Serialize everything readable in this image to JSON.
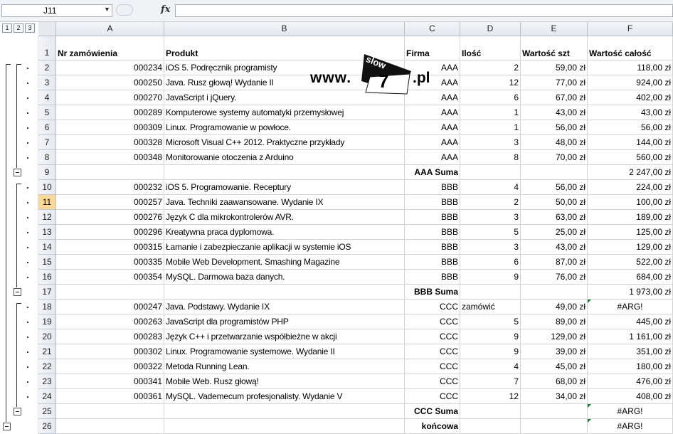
{
  "formula_bar": {
    "name_box": "J11",
    "fx_label": "fx",
    "formula": ""
  },
  "outline_levels": [
    "1",
    "2",
    "3"
  ],
  "columns": [
    "A",
    "B",
    "C",
    "D",
    "E",
    "F"
  ],
  "logo": {
    "www": "www.",
    "slow": "slow",
    "seven": "7",
    "pl": ".pl"
  },
  "active_row": "11",
  "rows": [
    {
      "n": "1",
      "a": "Nr zamówienia",
      "b": "Produkt",
      "c": "Firma",
      "d": "Ilość",
      "e": "Wartość szt",
      "f": "Wartość całość",
      "type": "header"
    },
    {
      "n": "2",
      "a": "000234",
      "b": "iOS 5. Podręcznik programisty",
      "c": "AAA",
      "d": "2",
      "e": "59,00 zł",
      "f": "118,00 zł",
      "type": "data"
    },
    {
      "n": "3",
      "a": "000250",
      "b": "Java. Rusz głową! Wydanie II",
      "c": "AAA",
      "d": "12",
      "e": "77,00 zł",
      "f": "924,00 zł",
      "type": "data"
    },
    {
      "n": "4",
      "a": "000270",
      "b": "JavaScript i jQuery.",
      "c": "AAA",
      "d": "6",
      "e": "67,00 zł",
      "f": "402,00 zł",
      "type": "data"
    },
    {
      "n": "5",
      "a": "000289",
      "b": "Komputerowe systemy automatyki przemysłowej",
      "c": "AAA",
      "d": "1",
      "e": "43,00 zł",
      "f": "43,00 zł",
      "type": "data"
    },
    {
      "n": "6",
      "a": "000309",
      "b": "Linux. Programowanie w powłoce.",
      "c": "AAA",
      "d": "1",
      "e": "56,00 zł",
      "f": "56,00 zł",
      "type": "data"
    },
    {
      "n": "7",
      "a": "000328",
      "b": "Microsoft Visual C++ 2012. Praktyczne przykłady",
      "c": "AAA",
      "d": "3",
      "e": "48,00 zł",
      "f": "144,00 zł",
      "type": "data"
    },
    {
      "n": "8",
      "a": "000348",
      "b": "Monitorowanie otoczenia z Arduino",
      "c": "AAA",
      "d": "8",
      "e": "70,00 zł",
      "f": "560,00 zł",
      "type": "data"
    },
    {
      "n": "9",
      "a": "",
      "b": "",
      "c": "AAA Suma",
      "d": "",
      "e": "",
      "f": "2 247,00 zł",
      "type": "sum"
    },
    {
      "n": "10",
      "a": "000232",
      "b": "iOS 5. Programowanie. Receptury",
      "c": "BBB",
      "d": "4",
      "e": "56,00 zł",
      "f": "224,00 zł",
      "type": "data"
    },
    {
      "n": "11",
      "a": "000257",
      "b": "Java. Techniki zaawansowane. Wydanie IX",
      "c": "BBB",
      "d": "2",
      "e": "50,00 zł",
      "f": "100,00 zł",
      "type": "data"
    },
    {
      "n": "12",
      "a": "000276",
      "b": "Język C dla mikrokontrolerów AVR.",
      "c": "BBB",
      "d": "3",
      "e": "63,00 zł",
      "f": "189,00 zł",
      "type": "data"
    },
    {
      "n": "13",
      "a": "000296",
      "b": "Kreatywna praca dyplomowa.",
      "c": "BBB",
      "d": "5",
      "e": "25,00 zł",
      "f": "125,00 zł",
      "type": "data"
    },
    {
      "n": "14",
      "a": "000315",
      "b": "Łamanie i zabezpieczanie aplikacji w systemie iOS",
      "c": "BBB",
      "d": "3",
      "e": "43,00 zł",
      "f": "129,00 zł",
      "type": "data"
    },
    {
      "n": "15",
      "a": "000335",
      "b": "Mobile Web Development. Smashing Magazine",
      "c": "BBB",
      "d": "6",
      "e": "87,00 zł",
      "f": "522,00 zł",
      "type": "data"
    },
    {
      "n": "16",
      "a": "000354",
      "b": "MySQL. Darmowa baza danych.",
      "c": "BBB",
      "d": "9",
      "e": "76,00 zł",
      "f": "684,00 zł",
      "type": "data"
    },
    {
      "n": "17",
      "a": "",
      "b": "",
      "c": "BBB Suma",
      "d": "",
      "e": "",
      "f": "1 973,00 zł",
      "type": "sum"
    },
    {
      "n": "18",
      "a": "000247",
      "b": "Java. Podstawy. Wydanie IX",
      "c": "CCC",
      "d": "zamówić",
      "e": "49,00 zł",
      "f": "#ARG!",
      "type": "data",
      "d_left": true,
      "f_flag": true,
      "f_center": true
    },
    {
      "n": "19",
      "a": "000263",
      "b": "JavaScript dla programistów PHP",
      "c": "CCC",
      "d": "5",
      "e": "89,00 zł",
      "f": "445,00 zł",
      "type": "data"
    },
    {
      "n": "20",
      "a": "000283",
      "b": "Język C++ i przetwarzanie współbieżne w akcji",
      "c": "CCC",
      "d": "9",
      "e": "129,00 zł",
      "f": "1 161,00 zł",
      "type": "data"
    },
    {
      "n": "21",
      "a": "000302",
      "b": "Linux. Programowanie systemowe. Wydanie II",
      "c": "CCC",
      "d": "9",
      "e": "39,00 zł",
      "f": "351,00 zł",
      "type": "data"
    },
    {
      "n": "22",
      "a": "000322",
      "b": "Metoda Running Lean.",
      "c": "CCC",
      "d": "4",
      "e": "45,00 zł",
      "f": "180,00 zł",
      "type": "data"
    },
    {
      "n": "23",
      "a": "000341",
      "b": "Mobile Web. Rusz głową!",
      "c": "CCC",
      "d": "7",
      "e": "68,00 zł",
      "f": "476,00 zł",
      "type": "data"
    },
    {
      "n": "24",
      "a": "000361",
      "b": "MySQL. Vademecum profesjonalisty. Wydanie V",
      "c": "CCC",
      "d": "12",
      "e": "34,00 zł",
      "f": "408,00 zł",
      "type": "data"
    },
    {
      "n": "25",
      "a": "",
      "b": "",
      "c": "CCC Suma",
      "d": "",
      "e": "",
      "f": "#ARG!",
      "type": "sum",
      "f_flag": true,
      "f_center": true
    },
    {
      "n": "26",
      "a": "",
      "b": "",
      "c": "końcowa",
      "d": "",
      "e": "",
      "f": "#ARG!",
      "type": "sum",
      "f_flag": true,
      "f_center": true
    }
  ]
}
